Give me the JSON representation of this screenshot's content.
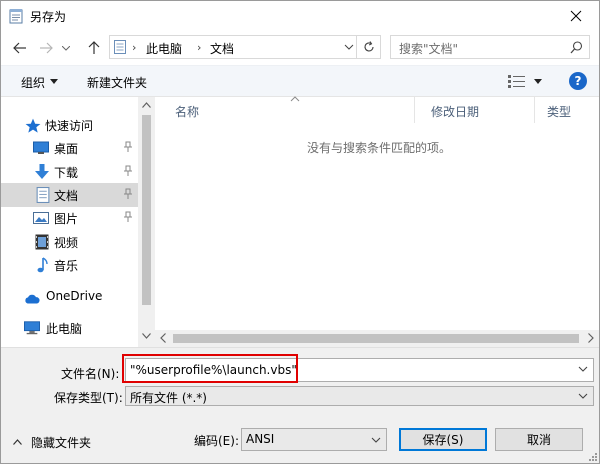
{
  "window": {
    "title": "另存为"
  },
  "nav": {
    "breadcrumbs": [
      "此电脑",
      "文档"
    ],
    "search_placeholder": "搜索\"文档\""
  },
  "toolbar": {
    "organize": "组织",
    "new_folder": "新建文件夹",
    "help": "?"
  },
  "sidebar": {
    "quick_access": "快速访问",
    "items": [
      {
        "label": "桌面",
        "icon": "desktop-icon",
        "pinned": true
      },
      {
        "label": "下载",
        "icon": "download-icon",
        "pinned": true
      },
      {
        "label": "文档",
        "icon": "document-icon",
        "pinned": true,
        "selected": true
      },
      {
        "label": "图片",
        "icon": "picture-icon",
        "pinned": true
      },
      {
        "label": "视频",
        "icon": "video-icon",
        "pinned": false
      },
      {
        "label": "音乐",
        "icon": "music-icon",
        "pinned": false
      }
    ],
    "onedrive": "OneDrive",
    "this_pc": "此电脑"
  },
  "content": {
    "columns": [
      "名称",
      "修改日期",
      "类型"
    ],
    "empty_message": "没有与搜索条件匹配的项。"
  },
  "form": {
    "filename_label": "文件名(N):",
    "filename_value": "\"%userprofile%\\launch.vbs\"",
    "filetype_label": "保存类型(T):",
    "filetype_value": "所有文件  (*.*)",
    "encoding_label": "编码(E):",
    "encoding_value": "ANSI",
    "hide_folders": "隐藏文件夹",
    "save": "保存(S)",
    "cancel": "取消"
  },
  "colors": {
    "accent": "#0078d7",
    "highlight_border": "#e00000",
    "help_blue": "#1a67c9"
  }
}
